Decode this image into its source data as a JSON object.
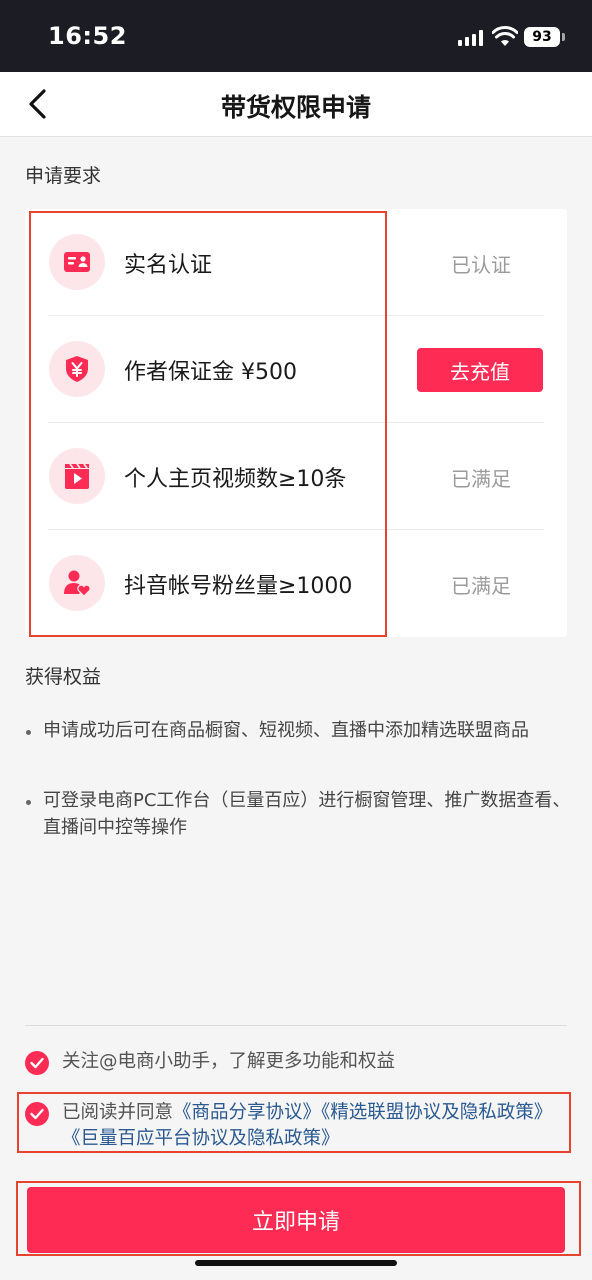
{
  "status_bar": {
    "time": "16:52",
    "battery": "93"
  },
  "header": {
    "title": "带货权限申请"
  },
  "requirements": {
    "section_title": "申请要求",
    "items": [
      {
        "label": "实名认证",
        "status": "已认证",
        "icon": "id-card-icon"
      },
      {
        "label": "作者保证金 ¥500",
        "action_label": "去充值",
        "icon": "yen-shield-icon"
      },
      {
        "label": "个人主页视频数≥10条",
        "status": "已满足",
        "icon": "video-clapper-icon"
      },
      {
        "label": "抖音帐号粉丝量≥1000",
        "status": "已满足",
        "icon": "fans-heart-icon"
      }
    ]
  },
  "benefits": {
    "section_title": "获得权益",
    "items": [
      "申请成功后可在商品橱窗、短视频、直播中添加精选联盟商品",
      "可登录电商PC工作台（巨量百应）进行橱窗管理、推广数据查看、直播间中控等操作"
    ]
  },
  "agreements": {
    "follow_text": "关注@电商小助手，了解更多功能和权益",
    "agree_prefix": "已阅读并同意",
    "links": [
      "《商品分享协议》",
      "《精选联盟协议及隐私政策》",
      "《巨量百应平台协议及隐私政策》"
    ]
  },
  "submit": {
    "label": "立即申请"
  },
  "colors": {
    "accent": "#fe2c55",
    "link": "#2a5a91",
    "annotation": "#e8432f",
    "status_bar_bg": "#1c1d24"
  }
}
